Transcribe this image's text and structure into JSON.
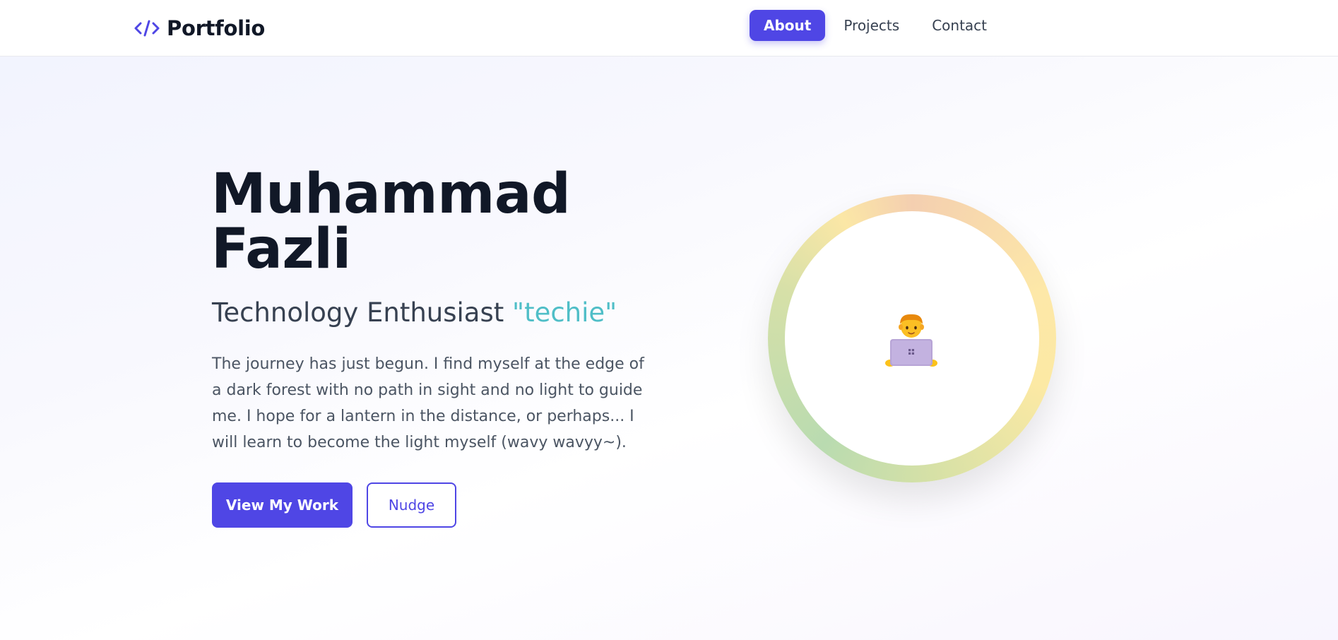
{
  "nav": {
    "brand": "Portfolio",
    "brand_icon": "code-icon",
    "links": [
      {
        "label": "About",
        "active": true
      },
      {
        "label": "Projects",
        "active": false
      },
      {
        "label": "Contact",
        "active": false
      }
    ]
  },
  "hero": {
    "name_first": "Muhammad",
    "name_last": "Fazli",
    "role": "Technology Enthusiast",
    "role_accent": "\"techie\"",
    "description": "The journey has just begun. I find myself at the edge of a dark forest with no path in sight and no light to guide me. I hope for a lantern in the distance, or perhaps... I will learn to become the light myself (wavy wavyy~).",
    "primary_button": "View My Work",
    "secondary_button": "Nudge",
    "avatar_icon": "technologist-icon"
  },
  "colors": {
    "accent": "#4f46e5",
    "role_accent": "#4fbec7",
    "heading": "#111827",
    "body_text": "#4b5563"
  }
}
